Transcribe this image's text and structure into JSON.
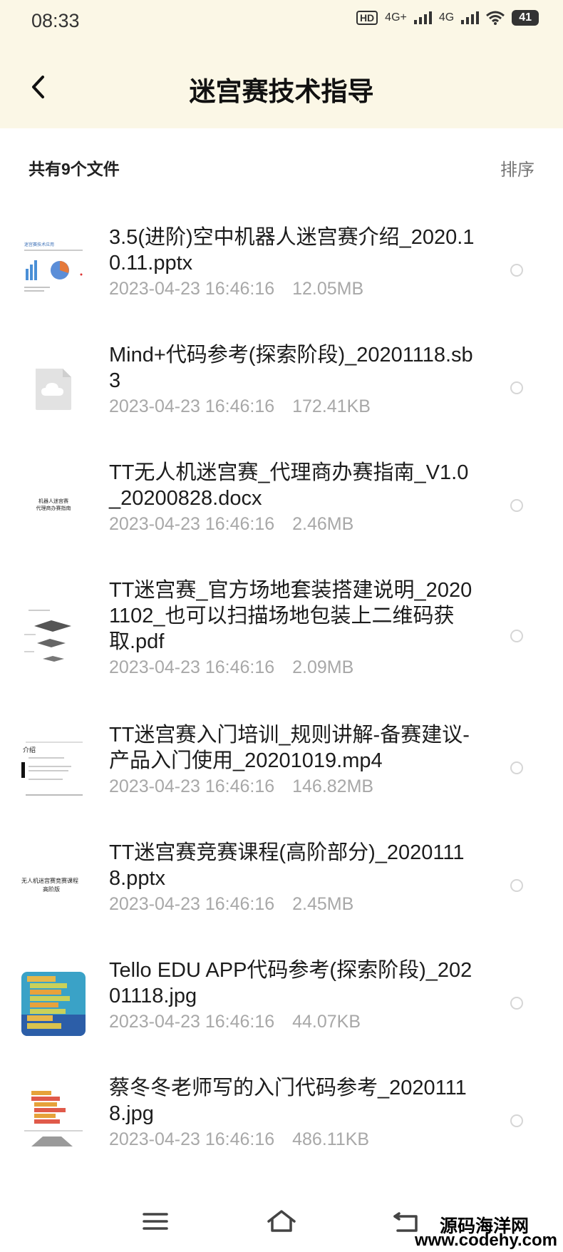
{
  "status": {
    "time": "08:33",
    "hd_label": "HD",
    "net1": "4G+",
    "net2": "4G",
    "battery": "41"
  },
  "header": {
    "title": "迷宫赛技术指导",
    "back_icon": "back-arrow-icon"
  },
  "summary": {
    "count_text": "共有9个文件",
    "sort_label": "排序"
  },
  "files": [
    {
      "name": "3.5(进阶)空中机器人迷宫赛介绍_2020.10.11.pptx",
      "date": "2023-04-23  16:46:16",
      "size": "12.05MB",
      "thumb": "pptx-slide-thumbnail"
    },
    {
      "name": "Mind+代码参考(探索阶段)_20201118.sb3",
      "date": "2023-04-23  16:46:16",
      "size": "172.41KB",
      "thumb": "cloud-file-icon"
    },
    {
      "name": "TT无人机迷宫赛_代理商办赛指南_V1.0_20200828.docx",
      "date": "2023-04-23  16:46:16",
      "size": "2.46MB",
      "thumb": "docx-thumbnail"
    },
    {
      "name": "TT迷宫赛_官方场地套装搭建说明_20201102_也可以扫描场地包装上二维码获取.pdf",
      "date": "2023-04-23  16:46:16",
      "size": "2.09MB",
      "thumb": "pdf-thumbnail"
    },
    {
      "name": "TT迷宫赛入门培训_规则讲解-备赛建议-产品入门使用_20201019.mp4",
      "date": "2023-04-23  16:46:16",
      "size": "146.82MB",
      "thumb": "video-thumbnail"
    },
    {
      "name": "TT迷宫赛竞赛课程(高阶部分)_20201118.pptx",
      "date": "2023-04-23  16:46:16",
      "size": "2.45MB",
      "thumb": "pptx-title-thumbnail"
    },
    {
      "name": "Tello EDU APP代码参考(探索阶段)_20201118.jpg",
      "date": "2023-04-23  16:46:16",
      "size": "44.07KB",
      "thumb": "code-blocks-image"
    },
    {
      "name": "蔡冬冬老师写的入门代码参考_20201118.jpg",
      "date": "2023-04-23  16:46:16",
      "size": "486.11KB",
      "thumb": "code-blocks-image"
    }
  ],
  "thumb_texts": {
    "pptx1_heading": "迷宫赛技术应用",
    "docx_line1": "机器人迷宫赛",
    "docx_line2": "代理商办赛指南",
    "video_heading": "介绍",
    "pptx2_line1": "无人机迷宫赛竞赛课程",
    "pptx2_line2": "高阶版"
  },
  "navbar": {
    "menu_icon": "menu-icon",
    "home_icon": "home-icon",
    "back_icon": "back-nav-icon"
  },
  "watermark": {
    "line1": "源码海洋网",
    "line2": "www.codehy.com"
  }
}
